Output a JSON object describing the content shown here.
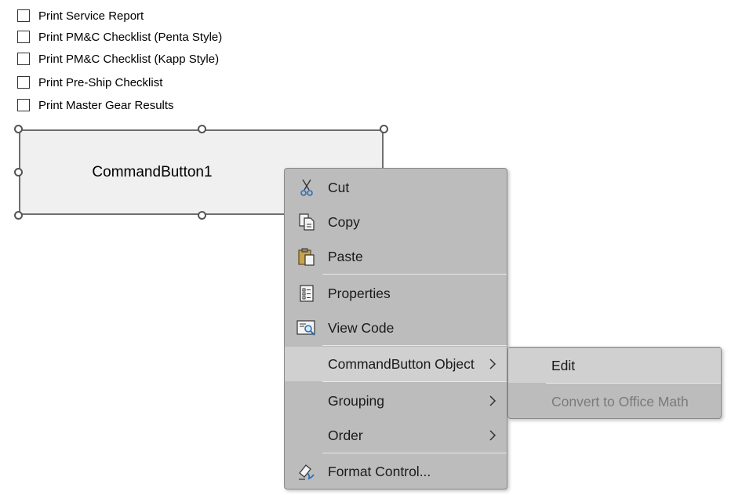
{
  "checkboxes": [
    {
      "label": "Print Service Report",
      "checked": false
    },
    {
      "label": "Print PM&C Checklist (Penta Style)",
      "checked": false
    },
    {
      "label": "Print PM&C Checklist (Kapp Style)",
      "checked": false
    },
    {
      "label": "Print Pre-Ship Checklist",
      "checked": false
    },
    {
      "label": "Print Master Gear Results",
      "checked": false
    }
  ],
  "command_button": {
    "label": "CommandButton1"
  },
  "context_menu": {
    "items": [
      {
        "label": "Cut",
        "icon": "scissors-icon"
      },
      {
        "label": "Copy",
        "icon": "copy-icon"
      },
      {
        "label": "Paste",
        "icon": "paste-icon"
      },
      {
        "label": "Properties",
        "icon": "properties-icon"
      },
      {
        "label": "View Code",
        "icon": "view-code-icon"
      },
      {
        "label": "CommandButton Object",
        "has_submenu": true,
        "highlighted": true
      },
      {
        "label": "Grouping",
        "has_submenu": true
      },
      {
        "label": "Order",
        "has_submenu": true
      },
      {
        "label": "Format Control...",
        "icon": "format-control-icon"
      }
    ]
  },
  "submenu": {
    "items": [
      {
        "label": "Edit",
        "highlighted": true
      },
      {
        "label": "Convert to Office Math",
        "disabled": true
      }
    ]
  },
  "colors": {
    "menu_bg": "#bcbcbc",
    "menu_highlight": "#d0d0d0",
    "button_bg": "#f0f0f0",
    "disabled_text": "#7a7a7a"
  }
}
